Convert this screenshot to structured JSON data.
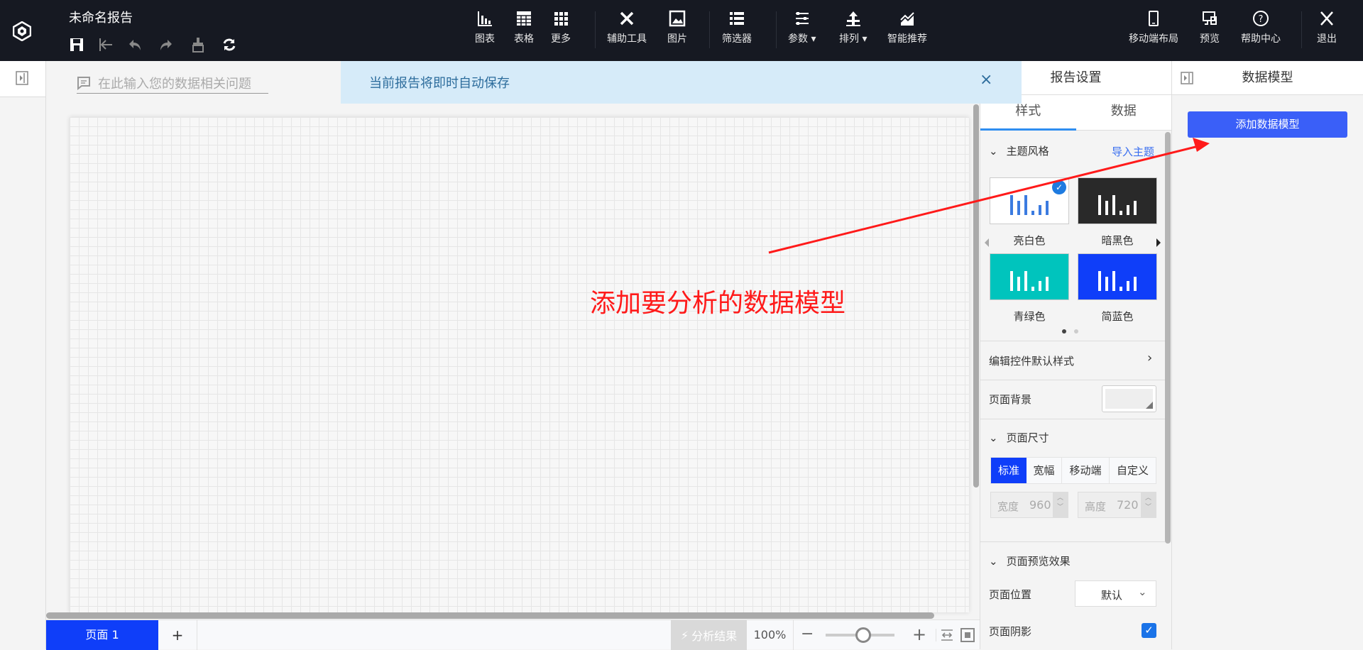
{
  "topbar": {
    "title": "未命名报告",
    "tools": [
      {
        "label": "图表",
        "icon": "bar-chart-icon"
      },
      {
        "label": "表格",
        "icon": "table-icon"
      },
      {
        "label": "更多",
        "icon": "grid-icon"
      },
      {
        "label": "辅助工具",
        "icon": "tools-icon"
      },
      {
        "label": "图片",
        "icon": "image-icon"
      },
      {
        "label": "筛选器",
        "icon": "list-icon"
      },
      {
        "label": "参数",
        "icon": "sliders-icon"
      },
      {
        "label": "排列",
        "icon": "arrange-icon"
      },
      {
        "label": "智能推荐",
        "icon": "smart-chart-icon"
      }
    ],
    "right": [
      {
        "label": "移动端布局"
      },
      {
        "label": "预览"
      },
      {
        "label": "帮助中心"
      },
      {
        "label": "退出"
      }
    ]
  },
  "question_input": {
    "placeholder": "在此输入您的数据相关问题"
  },
  "banner": {
    "text": "当前报告将即时自动保存",
    "close": "×"
  },
  "annotation": {
    "text": "添加要分析的数据模型",
    "color": "#ff1a1a"
  },
  "bottom": {
    "page_tab": "页面 1",
    "add": "+",
    "analysis": "分析结果",
    "zoom": "100%",
    "zoom_fraction": 0.55,
    "minus": "−",
    "plus": "+"
  },
  "report_settings": {
    "title": "报告设置",
    "tabs": [
      "样式",
      "数据"
    ],
    "theme": {
      "title": "主题风格",
      "import": "导入主题",
      "items": [
        {
          "label": "亮白色",
          "bg": "#ffffff",
          "bar": "#3b7be0",
          "selected": true
        },
        {
          "label": "暗黑色",
          "bg": "#292929",
          "bar": "#ffffff"
        },
        {
          "label": "青绿色",
          "bg": "#00c4bd",
          "bar": "#ffffff"
        },
        {
          "label": "简蓝色",
          "bg": "#0f3ef9",
          "bar": "#ffffff"
        }
      ]
    },
    "edit_default": "编辑控件默认样式",
    "page_bg": "页面背景",
    "page_size": {
      "title": "页面尺寸",
      "options": [
        "标准",
        "宽幅",
        "移动端",
        "自定义"
      ],
      "active": 0,
      "width_label": "宽度",
      "width": "960",
      "height_label": "高度",
      "height": "720"
    },
    "preview": {
      "title": "页面预览效果",
      "position_label": "页面位置",
      "position_value": "默认",
      "shadow_label": "页面阴影",
      "shadow_checked": true
    }
  },
  "data_model": {
    "title": "数据模型",
    "add_button": "添加数据模型"
  },
  "colors": {
    "accent": "#0f3ef9",
    "button": "#3a5ff8",
    "topbar": "#161922"
  }
}
